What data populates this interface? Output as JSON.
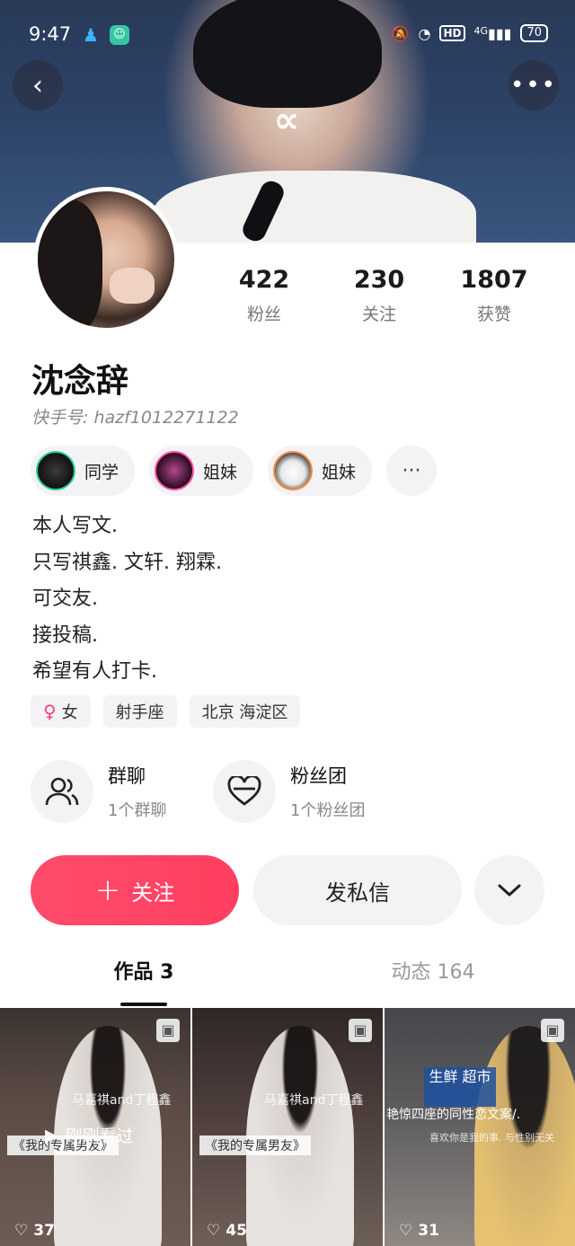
{
  "status_bar": {
    "time": "9:47",
    "hd": "HD",
    "network": "4G",
    "battery": "70"
  },
  "profile": {
    "stats": [
      {
        "value": "422",
        "label": "粉丝"
      },
      {
        "value": "230",
        "label": "关注"
      },
      {
        "value": "1807",
        "label": "获赞"
      }
    ],
    "nickname": "沈念辞",
    "kuaishou_id": "快手号: hazf1012271122"
  },
  "friends": [
    {
      "label": "同学"
    },
    {
      "label": "姐妹"
    },
    {
      "label": "姐妹"
    }
  ],
  "bio": [
    "本人写文.",
    "只写祺鑫. 文轩. 翔霖.",
    "可交友.",
    "接投稿.",
    "希望有人打卡."
  ],
  "tags": {
    "gender_symbol": "♀",
    "gender": "女",
    "zodiac": "射手座",
    "location": "北京 海淀区"
  },
  "groups": {
    "group_chat": {
      "title": "群聊",
      "subtitle": "1个群聊"
    },
    "fan_club": {
      "title": "粉丝团",
      "subtitle": "1个粉丝团"
    }
  },
  "actions": {
    "follow": "关注",
    "message": "发私信"
  },
  "tabs": {
    "works": "作品 3",
    "moments": "动态 164"
  },
  "posts": [
    {
      "likes": "37",
      "watched": "刚刚看过",
      "title": "马嘉祺and丁程鑫",
      "subtitle": "《我的专属男友》"
    },
    {
      "likes": "45",
      "title": "马嘉祺and丁程鑫",
      "subtitle": "《我的专属男友》"
    },
    {
      "likes": "31",
      "title": "艳惊四座的同性恋文案/.",
      "sub_line": "喜欢你是我的事. 与性别无关",
      "sign": "生鲜 超市"
    }
  ],
  "colors": {
    "accent": "#ff4b6c",
    "muted_bg": "#f3f3f5",
    "female": "#ff3e7f"
  }
}
